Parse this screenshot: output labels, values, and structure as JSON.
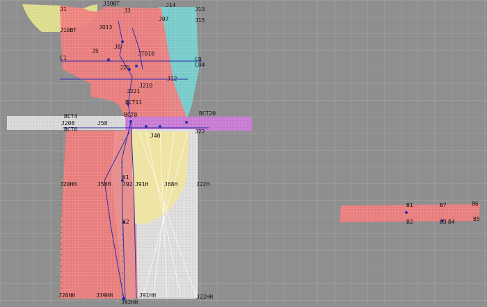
{
  "colors": {
    "background": "#8f8f8f",
    "front_panel": "#f07b7b",
    "back_panel": "#74d0d0",
    "collar": "#e6e38a",
    "waistband": "#d8d8d8",
    "belt_loop": "#c978d6",
    "lining": "#e6e6e6",
    "pocket": "#f0e39a",
    "guide_line": "#2b2bb0"
  },
  "labels": {
    "j1": "J1",
    "j3": "J3",
    "j3bt": "J3OBT",
    "j14": "J14",
    "j10bt": "J10BT",
    "j13": "J13",
    "j15": "J15",
    "j07": "J07",
    "jo13": "JO13",
    "j5": "J5",
    "jh": "J8",
    "jt010": "JT010",
    "c1": "C1",
    "c0": "C0",
    "c04": "C04",
    "j20": "J20",
    "j12": "J12",
    "j221": "J221",
    "j210": "J210",
    "bct11": "BCT11",
    "bct4": "BCT4",
    "bct6": "BCT6",
    "j208": "J208",
    "j58": "J58",
    "bct8": "BCT8",
    "bct20": "BCT20",
    "j22": "J22",
    "j40": "J40",
    "j20hh": "J20HH",
    "j58h": "J58H",
    "j92": "J92",
    "j91h": "J91H",
    "j68h": "J68H",
    "j22h": "J22H",
    "k1": "K1",
    "k2": "K2",
    "j20hh_b": "J20HH",
    "j39hh": "J39HH",
    "j92hh": "J92HH",
    "j91hh": "J91HH",
    "j22hh": "J22HH",
    "b1": "B1",
    "b2": "B2",
    "b3": "B3",
    "b4": "B4",
    "b5": "B5",
    "b6": "B6",
    "b7": "B7"
  }
}
